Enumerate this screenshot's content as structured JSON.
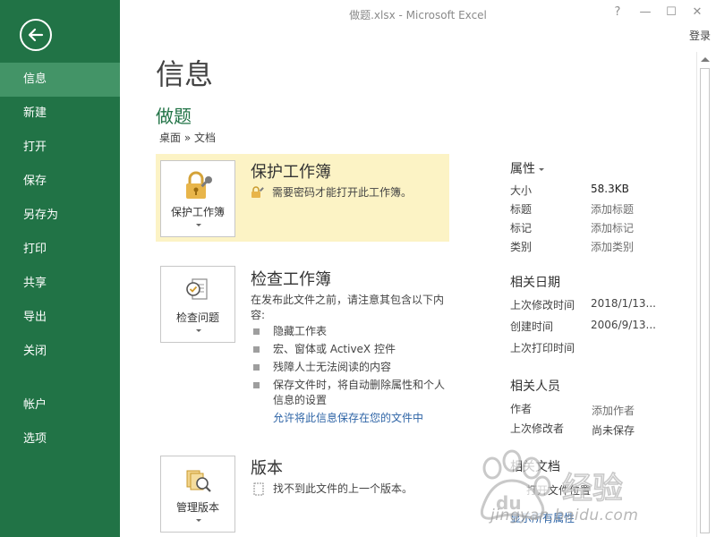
{
  "window": {
    "title": "做题.xlsx - Microsoft Excel",
    "help": "?",
    "minimize": "—",
    "maximize": "☐",
    "close": "✕",
    "signin": "登录"
  },
  "nav": {
    "items": [
      "信息",
      "新建",
      "打开",
      "保存",
      "另存为",
      "打印",
      "共享",
      "导出",
      "关闭"
    ],
    "items2": [
      "帐户",
      "选项"
    ],
    "active": "信息"
  },
  "main": {
    "title": "信息",
    "doc_name": "做题",
    "breadcrumb": "桌面 » 文档",
    "protect": {
      "button": "保护工作簿",
      "heading": "保护工作簿",
      "text": "需要密码才能打开此工作簿。",
      "highlight_color": "#fcf3c5"
    },
    "inspect": {
      "button": "检查问题",
      "heading": "检查工作簿",
      "desc": "在发布此文件之前，请注意其包含以下内容:",
      "bullets": [
        "隐藏工作表",
        "宏、窗体或 ActiveX 控件",
        "残障人士无法阅读的内容",
        "保存文件时，将自动删除属性和个人信息的设置"
      ],
      "link": "允许将此信息保存在您的文件中"
    },
    "versions": {
      "button": "管理版本",
      "heading": "版本",
      "text": "找不到此文件的上一个版本。"
    }
  },
  "properties": {
    "heading": "属性",
    "rows": [
      {
        "k": "大小",
        "v": "58.3KB"
      },
      {
        "k": "标题",
        "v": "添加标题"
      },
      {
        "k": "标记",
        "v": "添加标记"
      },
      {
        "k": "类别",
        "v": "添加类别"
      }
    ],
    "dates_heading": "相关日期",
    "dates": [
      {
        "k": "上次修改时间",
        "v": "2018/1/13..."
      },
      {
        "k": "创建时间",
        "v": "2006/9/13..."
      },
      {
        "k": "上次打印时间",
        "v": ""
      }
    ],
    "people_heading": "相关人员",
    "people": [
      {
        "k": "作者",
        "v": "添加作者"
      },
      {
        "k": "上次修改者",
        "v": "尚未保存"
      }
    ],
    "docs_heading": "相关文档",
    "open_location": "打开文件位置",
    "show_all": "显示所有属性"
  },
  "watermark": {
    "text": "Baidu经验",
    "url": "jingyan.baidu.com"
  },
  "colors": {
    "accent": "#217346",
    "nav_active": "#439467",
    "link": "#2e64a6"
  }
}
